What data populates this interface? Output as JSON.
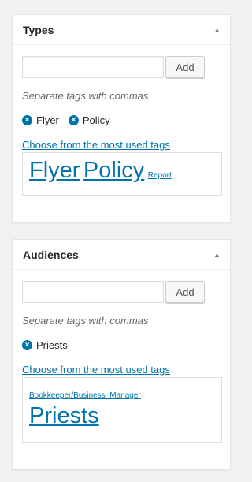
{
  "boxes": [
    {
      "title": "Types",
      "toggle_icon": "arrow-up-icon",
      "input_value": "",
      "add_label": "Add",
      "howto": "Separate tags with commas",
      "tags": [
        "Flyer",
        "Policy"
      ],
      "most_used_label": "Choose from the most used tags",
      "cloud": [
        "Flyer",
        "Policy",
        "Report"
      ]
    },
    {
      "title": "Audiences",
      "toggle_icon": "arrow-up-icon",
      "input_value": "",
      "add_label": "Add",
      "howto": "Separate tags with commas",
      "tags": [
        "Priests"
      ],
      "most_used_label": "Choose from the most used tags",
      "cloud": [
        "Bookkeeper/Business_Manager",
        "Priests"
      ]
    }
  ],
  "colors": {
    "link": "#0073aa",
    "background": "#f1f1f1",
    "panel": "#ffffff"
  }
}
